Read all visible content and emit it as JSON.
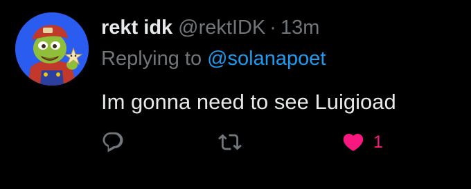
{
  "tweet": {
    "author": {
      "display_name": "rekt idk",
      "handle": "@rektIDK",
      "avatar_icon": "cartoon-frog-plumber-avatar"
    },
    "separator": "·",
    "time_ago": "13m",
    "replying_to": {
      "prefix": "Replying to",
      "handle": "@solanapoet"
    },
    "text": "Im gonna need to see Luigioad",
    "actions": {
      "reply_icon": "reply-icon",
      "retweet_icon": "retweet-icon",
      "like_icon": "heart-icon",
      "like_count": "1",
      "liked": true
    }
  },
  "colors": {
    "background": "#000000",
    "text": "#e7e9ea",
    "muted": "#71767b",
    "link": "#1d9bf0",
    "like": "#f91880",
    "avatar_bg": "#2a5cf0"
  }
}
